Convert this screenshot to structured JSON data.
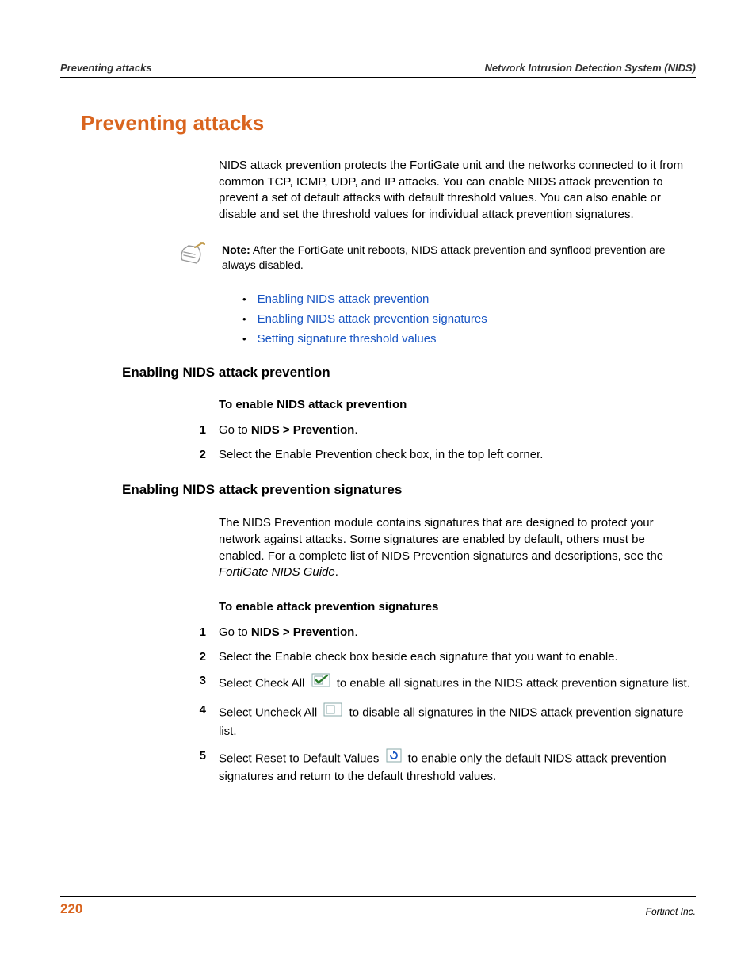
{
  "header": {
    "left": "Preventing attacks",
    "right": "Network Intrusion Detection System (NIDS)"
  },
  "title": "Preventing attacks",
  "intro": "NIDS attack prevention protects the FortiGate unit and the networks connected to it from common TCP, ICMP, UDP, and IP attacks. You can enable NIDS attack prevention to prevent a set of default attacks with default threshold values. You can also enable or disable and set the threshold values for individual attack prevention signatures.",
  "note": {
    "label": "Note:",
    "text": " After the FortiGate unit reboots, NIDS attack prevention and synflood prevention are always disabled."
  },
  "links": [
    "Enabling NIDS attack prevention",
    "Enabling NIDS attack prevention signatures",
    "Setting signature threshold values"
  ],
  "section1": {
    "heading": "Enabling NIDS attack prevention",
    "proc_title": "To enable NIDS attack prevention",
    "steps": {
      "s1_pre": "Go to ",
      "s1_bold": "NIDS > Prevention",
      "s1_post": ".",
      "s2": "Select the Enable Prevention check box, in the top left corner."
    }
  },
  "section2": {
    "heading": "Enabling NIDS attack prevention signatures",
    "intro_pre": "The NIDS Prevention module contains signatures that are designed to protect your network against attacks. Some signatures are enabled by default, others must be enabled. For a complete list of NIDS Prevention signatures and descriptions, see the ",
    "intro_italic": "FortiGate NIDS Guide",
    "intro_post": ".",
    "proc_title": "To enable attack prevention signatures",
    "steps": {
      "s1_pre": "Go to ",
      "s1_bold": "NIDS > Prevention",
      "s1_post": ".",
      "s2": "Select the Enable check box beside each signature that you want to enable.",
      "s3_pre": "Select Check All ",
      "s3_post": " to enable all signatures in the NIDS attack prevention signature list.",
      "s4_pre": "Select Uncheck All ",
      "s4_post": " to disable all signatures in the NIDS attack prevention signature list.",
      "s5_pre": "Select Reset to Default Values ",
      "s5_post": " to enable only the default NIDS attack prevention signatures and return to the default threshold values."
    }
  },
  "footer": {
    "page": "220",
    "company": "Fortinet Inc."
  },
  "nums": {
    "n1": "1",
    "n2": "2",
    "n3": "3",
    "n4": "4",
    "n5": "5"
  }
}
